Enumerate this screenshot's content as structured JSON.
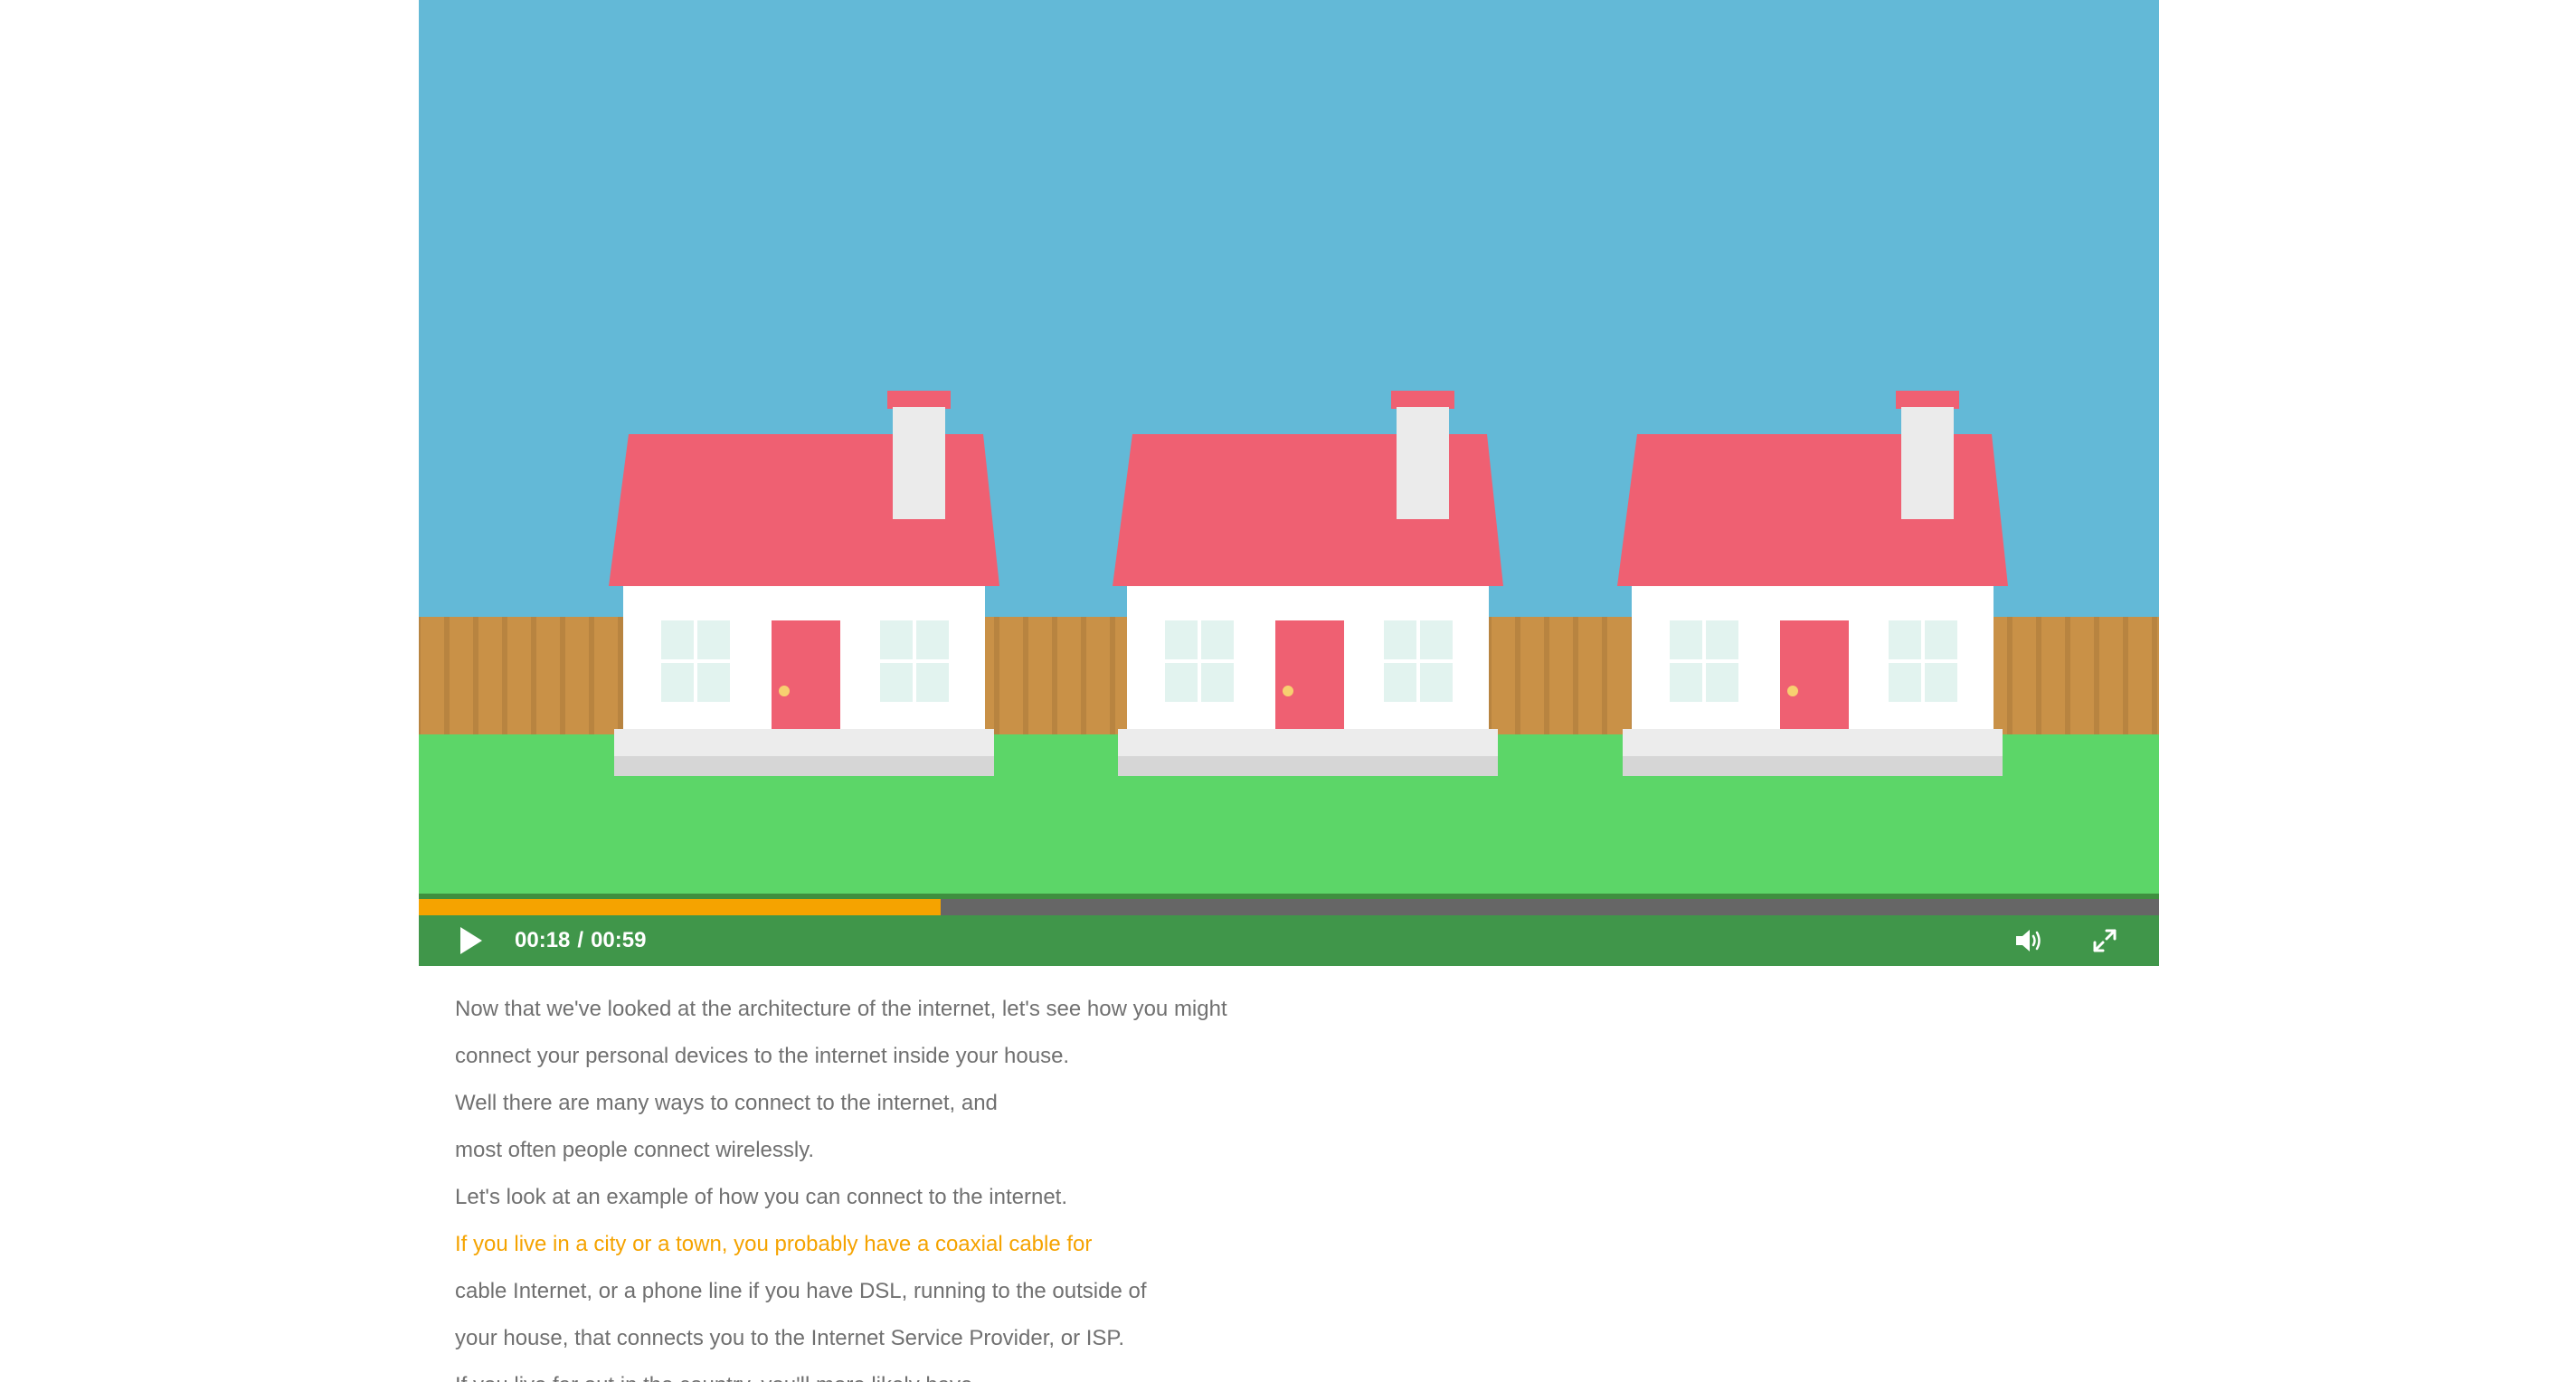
{
  "player": {
    "current_time": "00:18",
    "separator": "/",
    "duration": "00:59",
    "progress_fraction": 0.3,
    "colors": {
      "sky": "#63b9d7",
      "grass": "#5cd668",
      "fence": "#c99147",
      "roof": "#ef6072",
      "wall": "#ffffff",
      "window": "#e2f3ef",
      "door": "#ef6072",
      "knob": "#f7d070",
      "chimney": "#ebebeb",
      "progress_fill": "#f5a300",
      "progress_track": "#666666",
      "controls_bg": "#40964a"
    },
    "icons": {
      "play": "play-icon",
      "volume": "volume-icon",
      "fullscreen": "fullscreen-icon"
    }
  },
  "transcript": {
    "lines": [
      "Now that we've looked at the architecture of the internet, let's see how you might",
      "connect your personal devices to the internet inside your house.",
      "Well there are many ways to connect to the internet, and",
      "most often people connect wirelessly.",
      "Let's look at an example of how you can connect to the internet.",
      "If you live in a city or a town, you probably have a coaxial cable for",
      "cable Internet, or a phone line if you have DSL, running to the outside of",
      "your house, that connects you to the Internet Service Provider, or ISP.",
      "If you live far out in the country, you'll more likely have"
    ],
    "active_index": 5
  }
}
